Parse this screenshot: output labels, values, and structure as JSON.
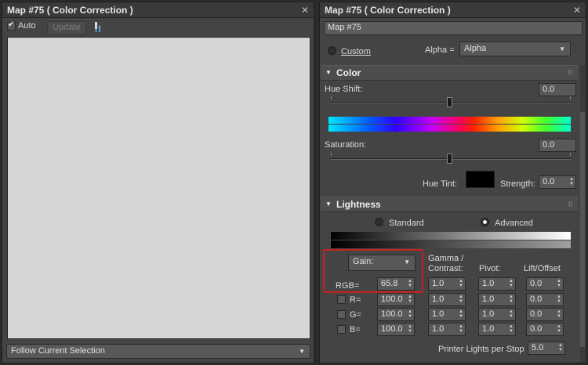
{
  "left_panel": {
    "title": "Map #75  ( Color Correction )",
    "close_glyph": "✕",
    "auto_label": "Auto",
    "update_label": "Update",
    "footer_dropdown": "Follow Current Selection"
  },
  "right_panel": {
    "title": "Map #75  ( Color Correction )",
    "close_glyph": "✕",
    "map_name": "Map #75",
    "custom_label": "Custom",
    "alpha_label": "Alpha =",
    "alpha_value": "Alpha",
    "color_section": {
      "title": "Color",
      "hue_shift_label": "Hue Shift:",
      "hue_shift_value": "0.0",
      "saturation_label": "Saturation:",
      "saturation_value": "0.0",
      "hue_tint_label": "Hue Tint:",
      "strength_label": "Strength:",
      "strength_value": "0.0"
    },
    "lightness_section": {
      "title": "Lightness",
      "standard_label": "Standard",
      "advanced_label": "Advanced",
      "mode_dropdown": "Gain:",
      "gamma_label_1": "Gamma /",
      "gamma_label_2": "Contrast:",
      "pivot_label": "Pivot:",
      "lift_label": "Lift/Offset",
      "rows": [
        {
          "label": "RGB=",
          "gain": "65.8",
          "gamma": "1.0",
          "pivot": "1.0",
          "lift": "0.0"
        },
        {
          "label": "R=",
          "gain": "100.0",
          "gamma": "1.0",
          "pivot": "1.0",
          "lift": "0.0"
        },
        {
          "label": "G=",
          "gain": "100.0",
          "gamma": "1.0",
          "pivot": "1.0",
          "lift": "0.0"
        },
        {
          "label": "B=",
          "gain": "100.0",
          "gamma": "1.0",
          "pivot": "1.0",
          "lift": "0.0"
        }
      ],
      "printer_label": "Printer Lights per Stop",
      "printer_value": "5.0"
    }
  },
  "colors": {
    "highlight": "#c8231e",
    "panel_bg": "#444444",
    "preview_bg": "#d6d6d6"
  }
}
